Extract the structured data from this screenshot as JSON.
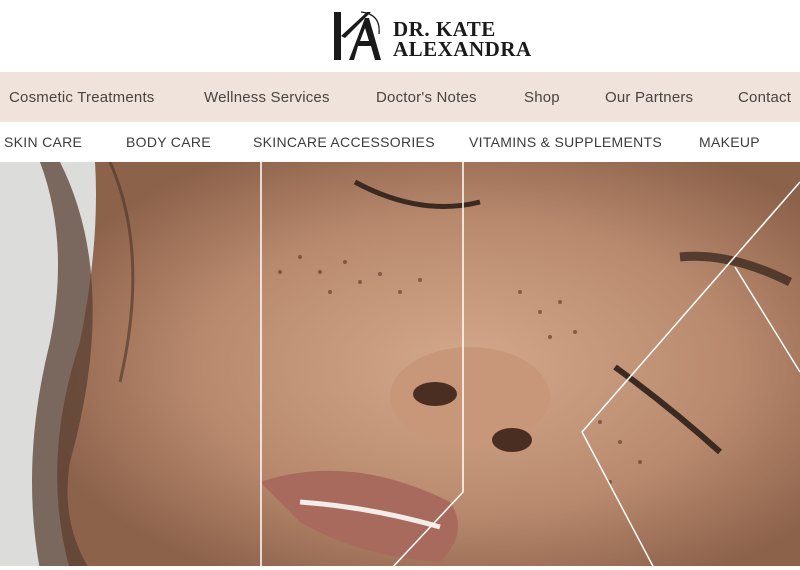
{
  "brand": {
    "monogram": "KA",
    "name_line1": "DR. KATE",
    "name_line2": "ALEXANDRA"
  },
  "main_nav": [
    {
      "label": "Cosmetic Treatments"
    },
    {
      "label": "Wellness Services"
    },
    {
      "label": "Doctor's Notes"
    },
    {
      "label": "Shop"
    },
    {
      "label": "Our Partners"
    },
    {
      "label": "Contact"
    }
  ],
  "sub_nav": [
    {
      "label": "SKIN CARE"
    },
    {
      "label": "BODY CARE"
    },
    {
      "label": "SKINCARE ACCESSORIES"
    },
    {
      "label": "VITAMINS & SUPPLEMENTS"
    },
    {
      "label": "MAKEUP"
    }
  ],
  "colors": {
    "main_nav_bg": "#efe3db",
    "text_dark": "#1a1a1a",
    "hero_line": "#ffffff"
  }
}
